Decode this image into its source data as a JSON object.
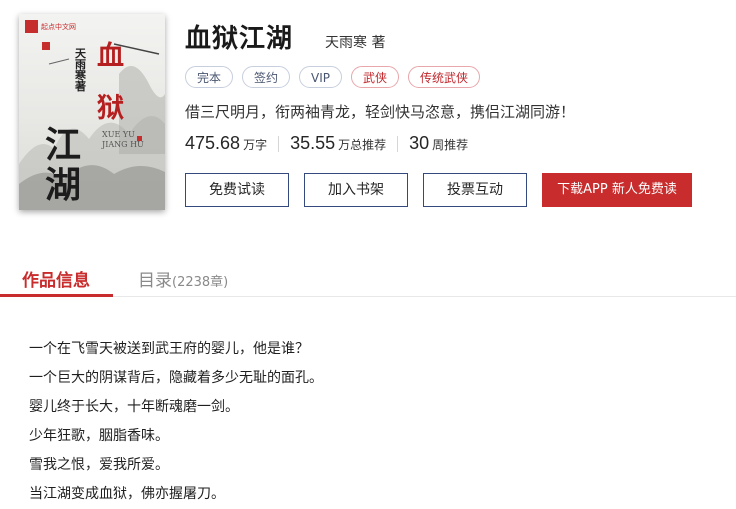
{
  "book": {
    "title": "血狱江湖",
    "author": "天雨寒 著",
    "tags": [
      "完本",
      "签约",
      "VIP",
      "武侠",
      "传统武侠"
    ],
    "intro": "借三尺明月，衔两袖青龙，轻剑快马恣意，携侣江湖同游！",
    "stats": {
      "words": {
        "num": "475.68",
        "unit": "万字"
      },
      "recommend_total": {
        "num": "35.55",
        "unit": "万总推荐"
      },
      "recommend_week": {
        "num": "30",
        "unit": "周推荐"
      }
    }
  },
  "cover": {
    "publisher": "起点中文网",
    "author_vertical": "天雨寒著",
    "title_red_1": "血",
    "title_red_2": "狱",
    "pinyin_1": "XUE YU",
    "pinyin_2": "JIANG HU",
    "title_black_1": "江",
    "title_black_2": "湖"
  },
  "buttons": {
    "free_read": "免费试读",
    "add_shelf": "加入书架",
    "vote": "投票互动",
    "download_app": "下载APP 新人免费读"
  },
  "tabs": {
    "info": "作品信息",
    "toc": "目录",
    "toc_count": "(2238章)"
  },
  "description": [
    "一个在飞雪天被送到武王府的婴儿，他是谁？",
    "一个巨大的阴谋背后，隐藏着多少无耻的面孔。",
    "婴儿终于长大，十年断魂磨一剑。",
    "少年狂歌，胭脂香味。",
    "雪我之恨，爱我所爱。",
    "当江湖变成血狱，佛亦握屠刀。"
  ],
  "colors": {
    "accent": "#c92c2c",
    "button_border": "#344a7e",
    "tag_border": "#c7cedd"
  }
}
